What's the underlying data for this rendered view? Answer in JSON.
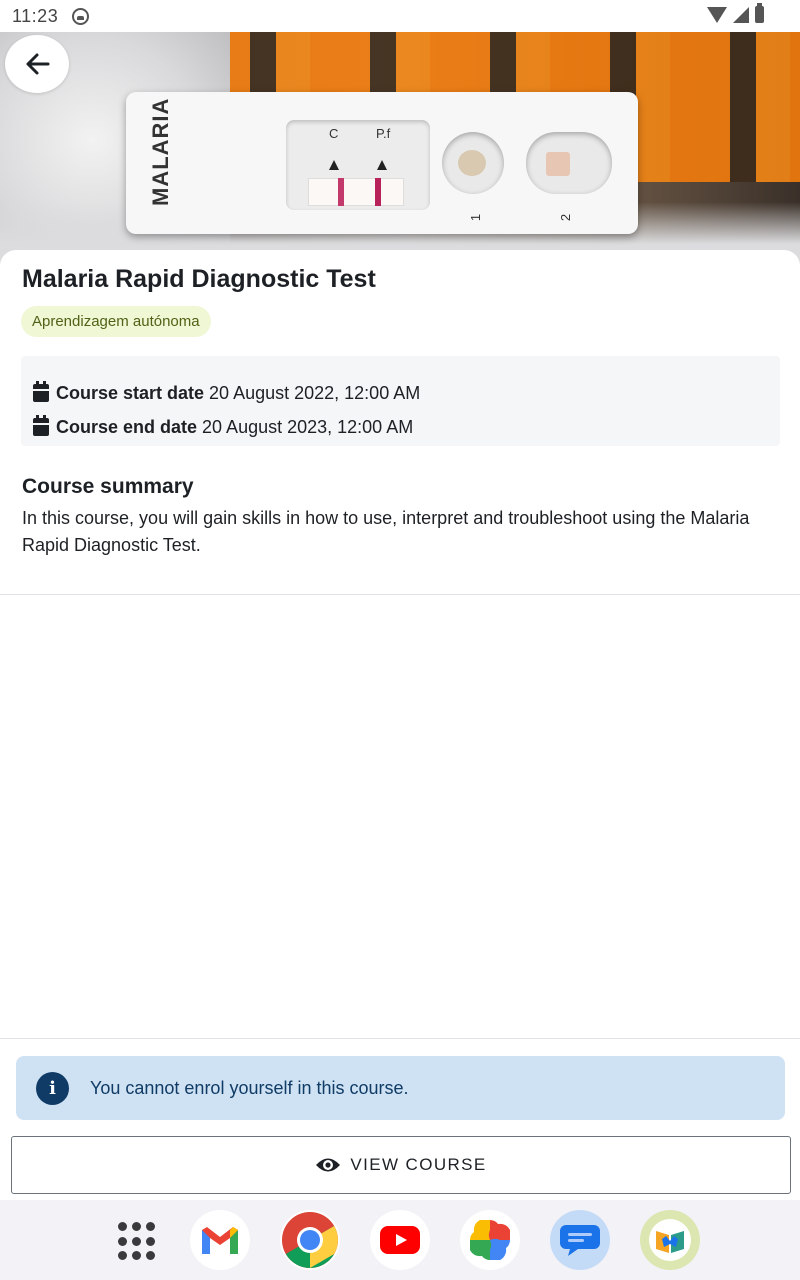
{
  "status_bar": {
    "time": "11:23"
  },
  "hero": {
    "cassette_text": "MALARIA",
    "marker_c": "C",
    "marker_pf": "P.f",
    "well_1": "1",
    "well_2": "2"
  },
  "course": {
    "title": "Malaria Rapid Diagnostic Test",
    "badge": "Aprendizagem autónoma",
    "start_label": "Course start date",
    "start_value": "20 August 2022, 12:00 AM",
    "end_label": "Course end date",
    "end_value": "20 August 2023, 12:00 AM",
    "summary_title": "Course summary",
    "summary_text": "In this course, you will gain skills in how to use, interpret and troubleshoot using the Malaria Rapid Diagnostic Test."
  },
  "alert": {
    "icon": "info-icon",
    "text": "You cannot enrol yourself in this course."
  },
  "actions": {
    "view_course_label": "VIEW COURSE"
  },
  "dock": {
    "apps": [
      "app-drawer",
      "gmail",
      "chrome",
      "youtube",
      "photos",
      "messages",
      "moodle"
    ]
  },
  "colors": {
    "badge_bg": "#f0f7d5",
    "badge_text": "#4f6216",
    "alert_bg": "#cfe2f3",
    "alert_text": "#0f3b66"
  }
}
